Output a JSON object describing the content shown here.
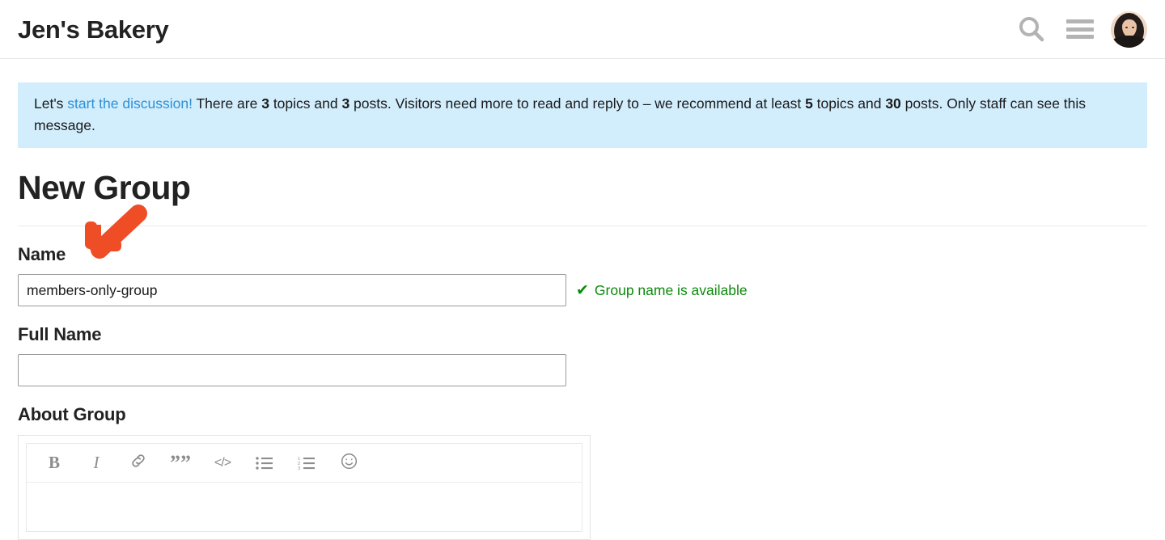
{
  "header": {
    "site_title": "Jen's Bakery",
    "search_icon": "search-icon",
    "menu_icon": "hamburger-menu-icon",
    "avatar_icon": "user-avatar"
  },
  "notice": {
    "lead": "Let's ",
    "link_text": "start the discussion!",
    "part1": " There are ",
    "topics_count": "3",
    "part2": " topics and ",
    "posts_count": "3",
    "part3": " posts. Visitors need more to read and reply to – we recommend at least ",
    "rec_topics": "5",
    "part4": " topics and ",
    "rec_posts": "30",
    "part5": " posts. Only staff can see this message."
  },
  "main": {
    "page_title": "New Group",
    "name": {
      "label": "Name",
      "value": "members-only-group",
      "placeholder": "",
      "availability_text": "Group name is available",
      "availability_icon": "check-icon",
      "availability_color": "#0c8a0c"
    },
    "full_name": {
      "label": "Full Name",
      "value": "",
      "placeholder": ""
    },
    "about_group": {
      "label": "About Group",
      "value": "",
      "toolbar": [
        {
          "name": "bold-icon",
          "label": "B",
          "title": "Bold"
        },
        {
          "name": "italic-icon",
          "label": "I",
          "title": "Italic"
        },
        {
          "name": "link-icon",
          "label": "",
          "title": "Link"
        },
        {
          "name": "quote-icon",
          "label": "””",
          "title": "Blockquote"
        },
        {
          "name": "code-icon",
          "label": "</>",
          "title": "Code"
        },
        {
          "name": "bulleted-list-icon",
          "label": "",
          "title": "Bulleted list"
        },
        {
          "name": "numbered-list-icon",
          "label": "",
          "title": "Numbered list"
        },
        {
          "name": "emoji-icon",
          "label": "",
          "title": "Emoji"
        }
      ]
    }
  },
  "annotation": {
    "arrow_color": "#ef4d26",
    "arrow_name": "annotation-arrow-pointing-to-name-field"
  }
}
